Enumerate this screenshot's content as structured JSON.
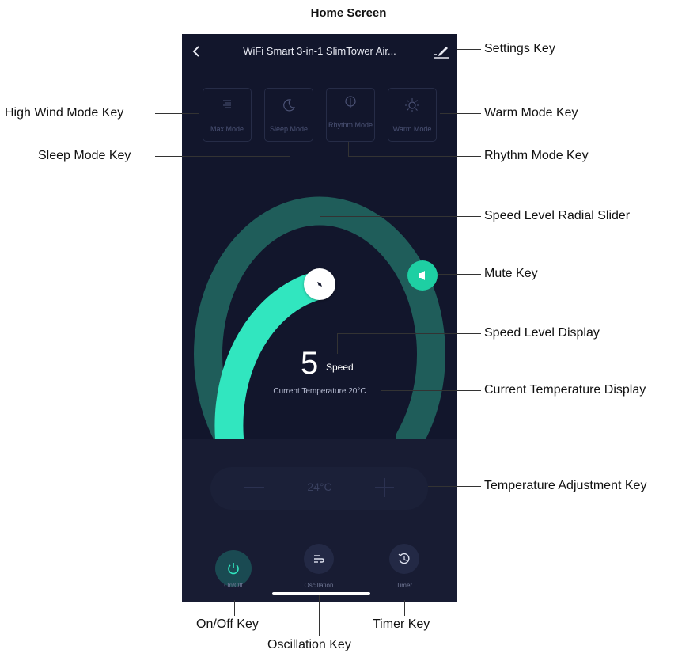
{
  "heading": "Home Screen",
  "app": {
    "title": "WiFi Smart 3-in-1 SlimTower Air...",
    "modes": [
      {
        "label": "Max Mode",
        "icon": "max-mode-icon"
      },
      {
        "label": "Sleep Mode",
        "icon": "moon-icon"
      },
      {
        "label": "Rhythm Mode",
        "icon": "leaf-icon"
      },
      {
        "label": "Warm Mode",
        "icon": "sun-icon"
      }
    ],
    "speed_value": "5",
    "speed_label": "Speed",
    "current_temperature": "Current Temperature 20°C",
    "set_temperature": "24°C",
    "bottom_buttons": [
      {
        "label": "On/Off",
        "icon": "power-icon"
      },
      {
        "label": "Oscillation",
        "icon": "oscillation-icon"
      },
      {
        "label": "Timer",
        "icon": "timer-icon"
      }
    ],
    "colors": {
      "background": "#12162c",
      "accent": "#31e6bf",
      "arc_track": "#1f5d5a",
      "mute": "#1ecfa3"
    }
  },
  "callouts": {
    "settings": "Settings Key",
    "high_wind": "High Wind Mode Key",
    "warm": "Warm Mode Key",
    "sleep": "Sleep Mode Key",
    "rhythm": "Rhythm Mode Key",
    "speed_slider": "Speed Level Radial Slider",
    "mute": "Mute Key",
    "speed_display": "Speed Level Display",
    "current_temp": "Current Temperature Display",
    "temp_adjust": "Temperature Adjustment Key",
    "on_off": "On/Off Key",
    "timer": "Timer Key",
    "oscillation": "Oscillation Key"
  }
}
